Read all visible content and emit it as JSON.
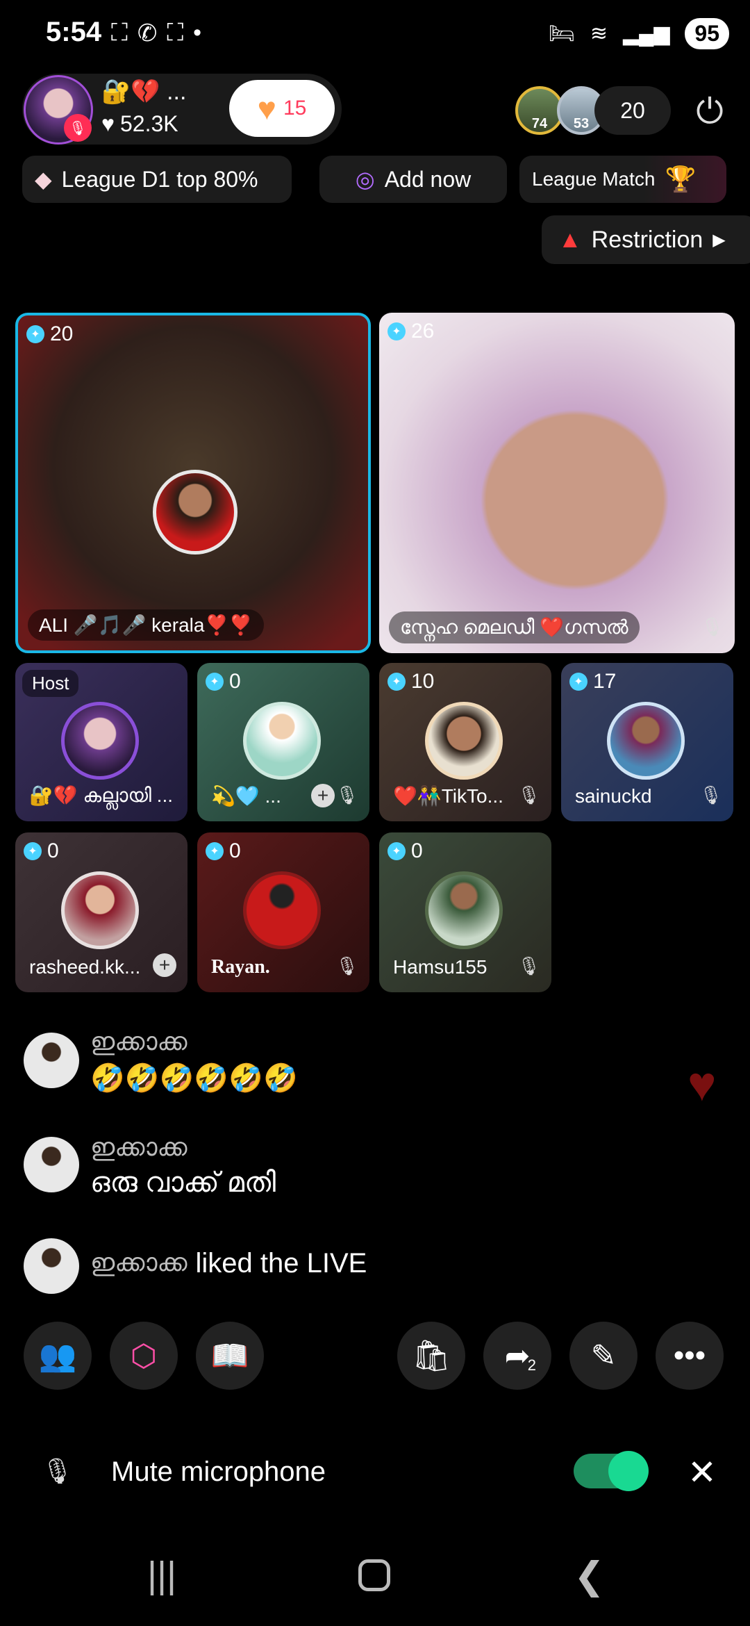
{
  "status_bar": {
    "time": "5:54",
    "left_icons": [
      "scan-icon",
      "whatsapp-icon",
      "scan-icon",
      "dot-icon"
    ],
    "battery": "95",
    "right_icons": [
      "bed-icon",
      "wifi-icon",
      "signal-icon"
    ]
  },
  "host": {
    "name": "🔐💔 ...",
    "likes": "52.3K",
    "gift_count": "15"
  },
  "viewers": {
    "top1_level": "74",
    "top2_level": "53",
    "count": "20"
  },
  "chips": {
    "league": "League D1 top 80%",
    "add": "Add now",
    "match": "League Match"
  },
  "restriction": {
    "label": "Restriction"
  },
  "tiles": [
    {
      "level": "20",
      "name": "ALI 🎤🎵🎤 kerala❣️❣️"
    },
    {
      "level": "26",
      "name": "സ്നേഹ മെലഡീ ❤️ഗസൽ"
    },
    {
      "host_label": "Host",
      "name": "🔐💔 കല്ലായി ..."
    },
    {
      "level": "0",
      "name": "💫🩵 ..."
    },
    {
      "level": "10",
      "name": "❤️👫TikTo..."
    },
    {
      "level": "17",
      "name": "sainuckd"
    },
    {
      "level": "0",
      "name": "rasheed.kk..."
    },
    {
      "level": "0",
      "name": "Rayan."
    },
    {
      "level": "0",
      "name": "Hamsu155"
    }
  ],
  "comments": [
    {
      "user": "ഇക്കാക്ക",
      "text": "🤣🤣🤣🤣🤣🤣"
    },
    {
      "user": "ഇക്കാക്ക",
      "text": "ഒരു വാക്ക് മതി"
    },
    {
      "user": "ഇക്കാക്ക",
      "text": "liked the LIVE"
    }
  ],
  "share_count": "2",
  "mute_bar": {
    "label": "Mute microphone"
  },
  "colors": {
    "accent_tile_border": "#1ab8e6",
    "toggle": "#19d992",
    "gift_count": "#ff3b5c"
  }
}
